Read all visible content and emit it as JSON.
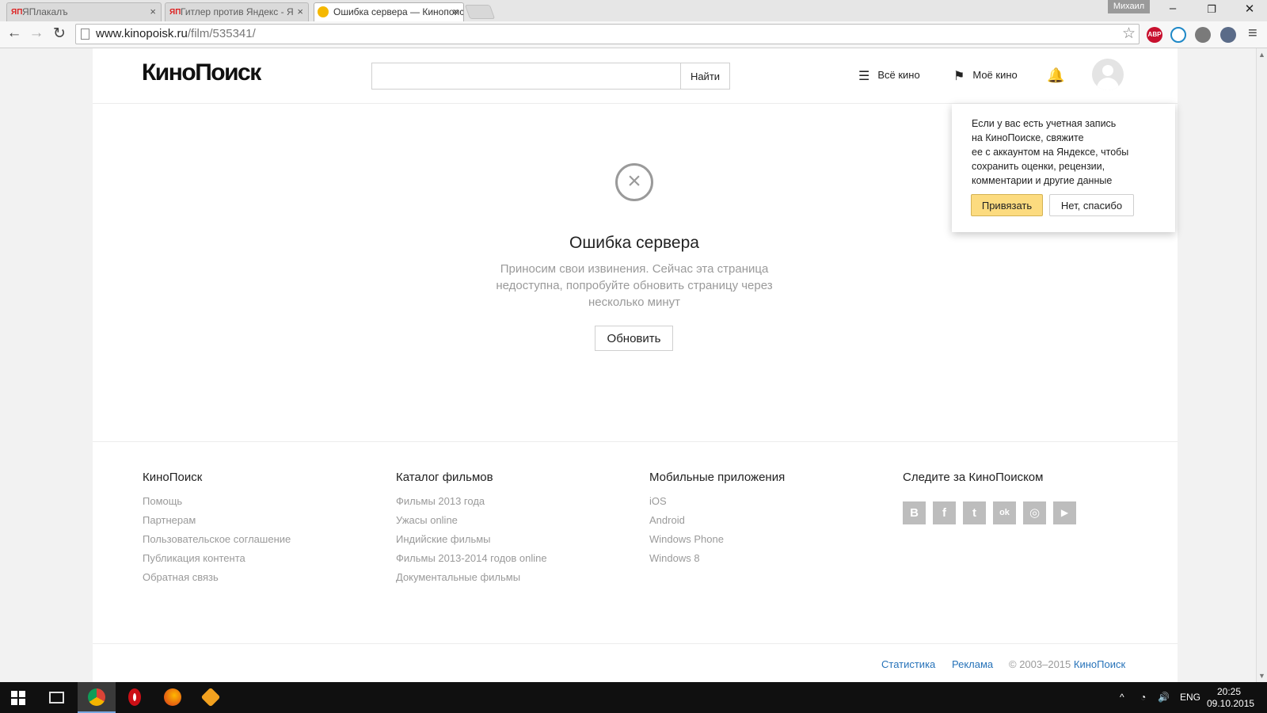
{
  "browser": {
    "tabs": [
      {
        "favicon": "ЯП",
        "title": "ЯПлакалъ",
        "active": false
      },
      {
        "favicon": "ЯП",
        "title": "Гитлер против Яндекс - Я",
        "active": false
      },
      {
        "favicon": "kinopoisk-icon",
        "title": "Ошибка сервера — Кинопоиск",
        "active": true
      }
    ],
    "tab_close": "×",
    "profile_name": "Михаил",
    "window": {
      "minimize": "–",
      "restore": "❐",
      "close": "✕"
    },
    "nav": {
      "back": "←",
      "forward": "→",
      "reload": "↻"
    },
    "url_host": "www.kinopoisk.ru",
    "url_path": "/film/535341/",
    "bookmark_star": "☆",
    "extensions": {
      "adblock_label": "ABP"
    },
    "menu": "≡"
  },
  "header": {
    "logo": "КиноПоиск",
    "search_placeholder": "",
    "search_button": "Найти",
    "nav": [
      {
        "icon": "menu-lines-icon",
        "glyph": "☰",
        "label": "Всё кино"
      },
      {
        "icon": "bookmark-icon",
        "glyph": "⚑",
        "label": "Моё кино"
      }
    ],
    "bell_glyph": "🔔"
  },
  "error": {
    "icon_glyph": "×",
    "title": "Ошибка сервера",
    "text": "Приносим свои извинения. Сейчас эта страница недоступна, попробуйте обновить страницу через несколько минут",
    "button": "Обновить"
  },
  "popup": {
    "line1": "Если у вас есть учетная запись",
    "line2": "на КиноПоиске, свяжите",
    "line3": "ее с аккаунтом на Яндексе, чтобы",
    "line4": "сохранить оценки, рецензии,",
    "line5": "комментарии и другие данные",
    "confirm": "Привязать",
    "decline": "Нет, спасибо"
  },
  "footer": {
    "columns": [
      {
        "heading": "КиноПоиск",
        "links": [
          "Помощь",
          "Партнерам",
          "Пользовательское соглашение",
          "Публикация контента",
          "Обратная связь"
        ]
      },
      {
        "heading": "Каталог фильмов",
        "links": [
          "Фильмы 2013 года",
          "Ужасы online",
          "Индийские фильмы",
          "Фильмы 2013-2014 годов online",
          "Документальные фильмы"
        ]
      },
      {
        "heading": "Мобильные приложения",
        "links": [
          "iOS",
          "Android",
          "Windows Phone",
          "Windows 8"
        ]
      },
      {
        "heading": "Следите за КиноПоиском",
        "links": []
      }
    ],
    "social": [
      {
        "icon": "vk-icon",
        "glyph": "B"
      },
      {
        "icon": "facebook-icon",
        "glyph": "f"
      },
      {
        "icon": "twitter-icon",
        "glyph": "t"
      },
      {
        "icon": "odnoklassniki-icon",
        "glyph": "ok"
      },
      {
        "icon": "instagram-icon",
        "glyph": "◎"
      },
      {
        "icon": "youtube-icon",
        "glyph": "▶"
      }
    ],
    "bottom_links": [
      "Статистика",
      "Реклама"
    ],
    "copyright_prefix": "© 2003–2015",
    "copyright_brand": "КиноПоиск"
  },
  "taskbar": {
    "lang": "ENG",
    "time": "20:25",
    "date": "09.10.2015",
    "tray_up": "^",
    "wifi": "◔",
    "volume": "🔊"
  },
  "colors": {
    "link": "#2773b9",
    "muted": "#9a9a9a",
    "accent_yellow": "#fcdb7f"
  }
}
